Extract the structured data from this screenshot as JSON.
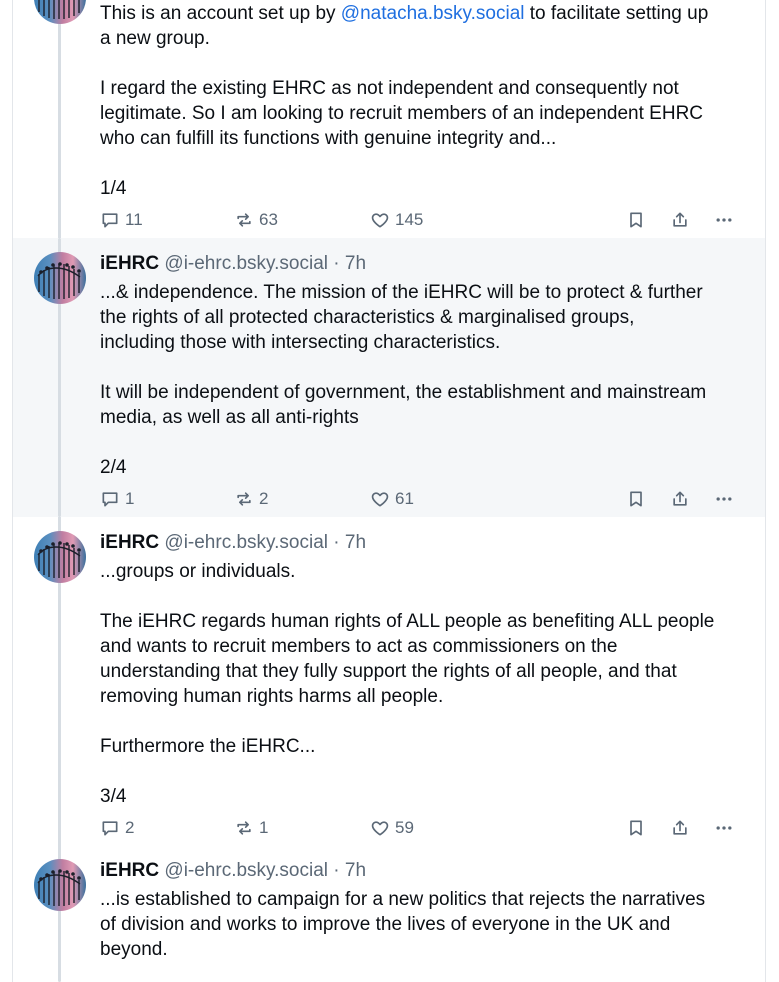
{
  "posts": [
    {
      "handle_name": "",
      "handle": "",
      "body_pre": "This is an account set up by ",
      "mention": "@natacha.bsky.social",
      "body_post": " to facilitate setting up\na new group.\n\nI regard the existing EHRC as not independent and consequently not\nlegitimate. So I am looking to recruit members of an independent EHRC\nwho can fulfill its functions with genuine integrity and...\n\n1/4",
      "replies": "11",
      "reposts": "63",
      "likes": "145"
    },
    {
      "name": "iEHRC",
      "handle": "@i-ehrc.bsky.social · 7h",
      "body": "...& independence. The mission of the iEHRC will be to protect & further\nthe rights of all protected characteristics & marginalised groups,\nincluding those with intersecting characteristics.\n\nIt will be independent of government, the establishment and mainstream\nmedia, as well as all anti-rights\n\n2/4",
      "replies": "1",
      "reposts": "2",
      "likes": "61"
    },
    {
      "name": "iEHRC",
      "handle": "@i-ehrc.bsky.social · 7h",
      "body": "...groups or individuals.\n\nThe iEHRC regards human rights of ALL people as benefiting ALL people\nand wants to recruit members to act as commissioners on the\nunderstanding that they fully support the rights of all people, and that\nremoving human rights harms all people.\n\nFurthermore the iEHRC...\n\n3/4",
      "replies": "2",
      "reposts": "1",
      "likes": "59"
    },
    {
      "name": "iEHRC",
      "handle": "@i-ehrc.bsky.social · 7h",
      "body": "...is established to campaign for a new politics that rejects the narratives\nof division and works to improve the lives of everyone in the UK and\nbeyond."
    }
  ],
  "colors": {
    "accent": "#1f6fe0",
    "muted": "#5b6876",
    "highlight_bg": "#f5f7f9",
    "thread_line": "#d7dde3"
  },
  "icons": {
    "reply": "reply-icon",
    "repost": "repost-icon",
    "like": "heart-icon",
    "bookmark": "bookmark-icon",
    "share": "share-icon",
    "more": "more-icon",
    "avatar": "avatar-image"
  }
}
